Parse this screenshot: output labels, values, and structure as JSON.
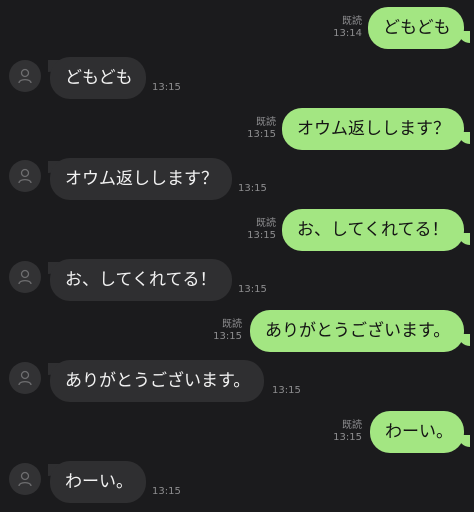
{
  "messages": [
    {
      "side": "sent",
      "text": "どもども",
      "read": "既読",
      "time": "13:14"
    },
    {
      "side": "recv",
      "text": "どもども",
      "time": "13:15"
    },
    {
      "side": "sent",
      "text": "オウム返しします？",
      "read": "既読",
      "time": "13:15"
    },
    {
      "side": "recv",
      "text": "オウム返しします？",
      "time": "13:15"
    },
    {
      "side": "sent",
      "text": "お、してくれてる！",
      "read": "既読",
      "time": "13:15"
    },
    {
      "side": "recv",
      "text": "お、してくれてる！",
      "time": "13:15"
    },
    {
      "side": "sent",
      "text": "ありがとうございます。",
      "read": "既読",
      "time": "13:15"
    },
    {
      "side": "recv",
      "text": "ありがとうございます。",
      "time": "13:15"
    },
    {
      "side": "sent",
      "text": "わーい。",
      "read": "既読",
      "time": "13:15"
    },
    {
      "side": "recv",
      "text": "わーい。",
      "time": "13:15"
    }
  ],
  "colors": {
    "background": "#1b1b1d",
    "sent_bubble": "#a3e682",
    "recv_bubble": "#2f2f31",
    "meta_text": "#8d8d8f"
  },
  "icons": {
    "avatar": "person-icon"
  }
}
